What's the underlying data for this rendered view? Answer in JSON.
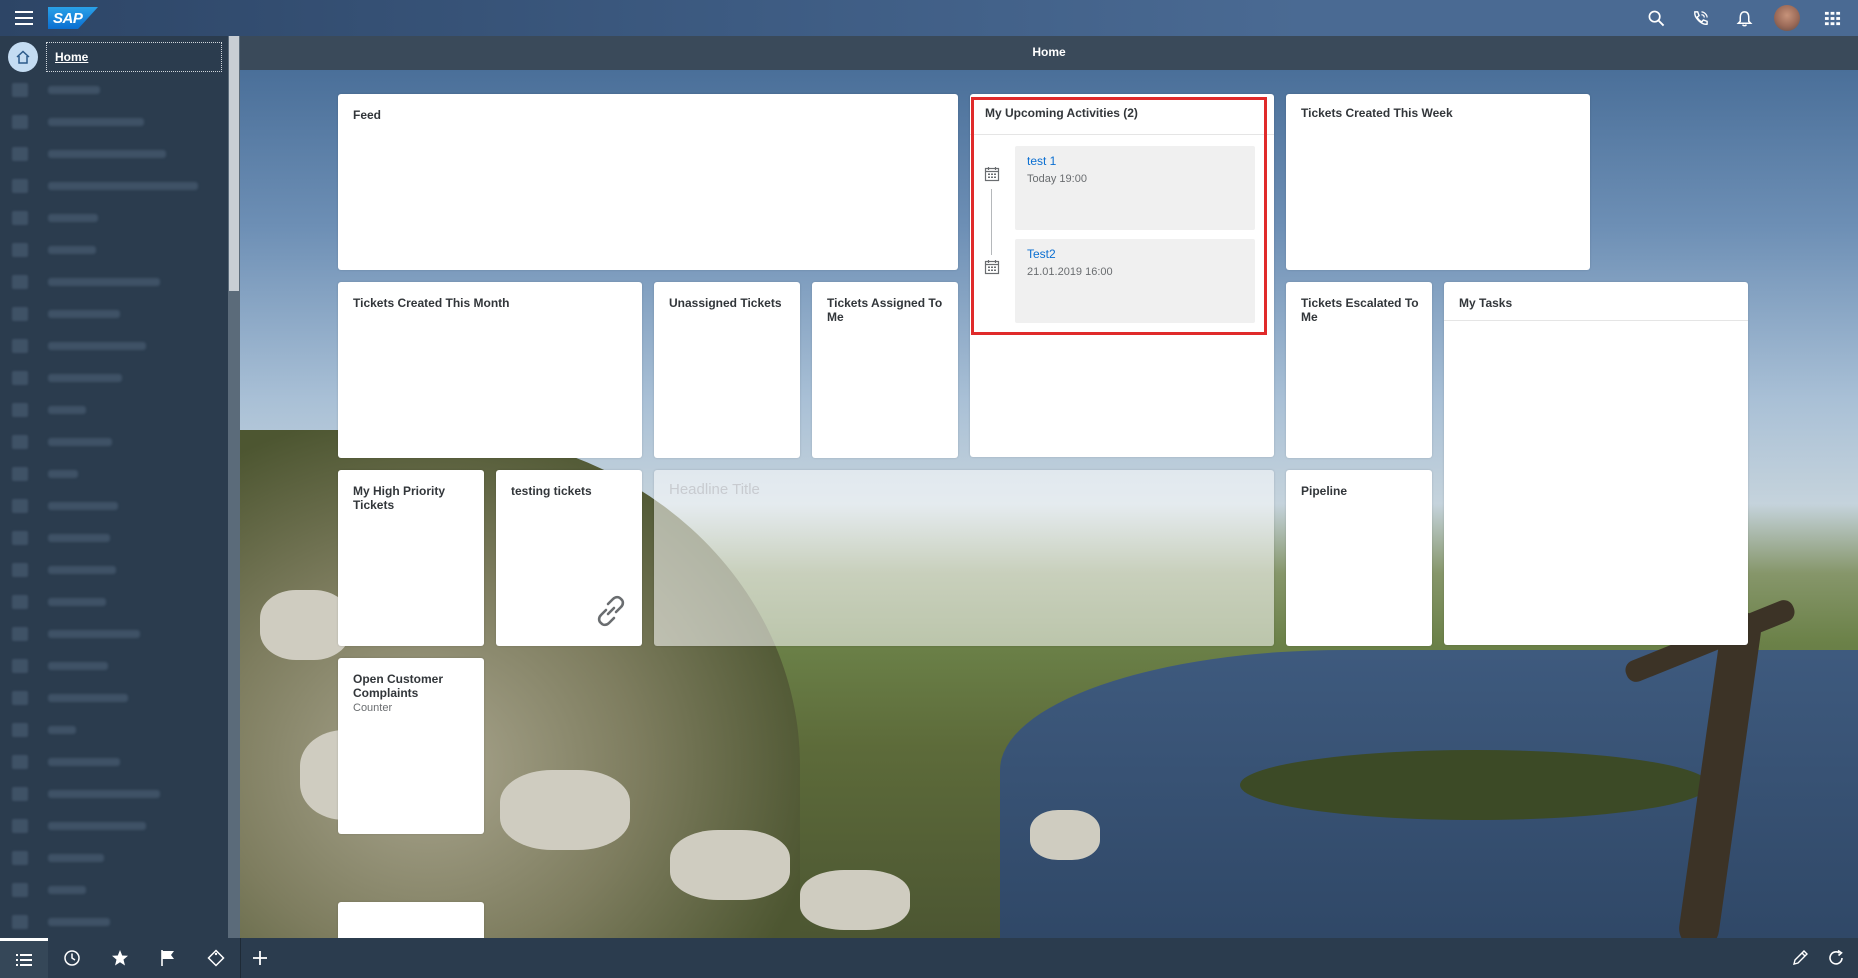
{
  "header": {
    "logo_text": "SAP",
    "icons": [
      "menu-icon",
      "search-icon",
      "phone-icon",
      "bell-icon",
      "avatar",
      "grid-icon"
    ]
  },
  "sidebar": {
    "home_label": "Home"
  },
  "page": {
    "title": "Home"
  },
  "tiles": {
    "feed": {
      "title": "Feed"
    },
    "activities": {
      "title": "My Upcoming Activities (2)",
      "items": [
        {
          "title": "test 1",
          "time": "Today 19:00"
        },
        {
          "title": "Test2",
          "time": "21.01.2019 16:00"
        }
      ]
    },
    "tickets_week": {
      "title": "Tickets Created This Week"
    },
    "tickets_month": {
      "title": "Tickets Created This Month"
    },
    "unassigned": {
      "title": "Unassigned Tickets"
    },
    "assigned_to_me": {
      "title": "Tickets Assigned To Me"
    },
    "escalated": {
      "title": "Tickets Escalated To Me"
    },
    "my_tasks": {
      "title": "My Tasks"
    },
    "high_priority": {
      "title": "My High Priority Tickets"
    },
    "testing": {
      "title": "testing tickets"
    },
    "headline": {
      "title": "Headline Title"
    },
    "pipeline": {
      "title": "Pipeline"
    },
    "complaints": {
      "title": "Open Customer Complaints",
      "subtitle": "Counter"
    }
  },
  "colors": {
    "shell": "#2b3c4e",
    "link": "#0a6ed1",
    "highlight": "#e02a2a"
  }
}
